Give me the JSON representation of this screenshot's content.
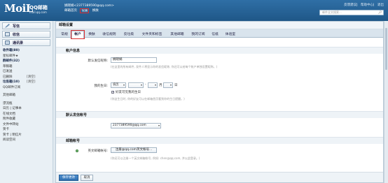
{
  "header": {
    "logo_mail": "MoiL",
    "logo_brand": "QQ邮箱",
    "logo_domain": "mail.qq.com",
    "user_line": "姚晓娟<2377389590@qq.com>",
    "nav_links": [
      "邮箱首页",
      "设置",
      "换肤"
    ],
    "top_right": [
      "反馈建议",
      "帮助中心",
      "退出"
    ],
    "search_placeholder": "邮件全文搜索..."
  },
  "sidebar": {
    "buttons": [
      {
        "label": "写信",
        "icon": "pencil-icon"
      },
      {
        "label": "收信",
        "icon": "inbox-icon"
      },
      {
        "label": "通讯录",
        "icon": "contacts-icon"
      }
    ],
    "items": [
      {
        "label": "收件箱(80)",
        "bold": true,
        "extra": ""
      },
      {
        "label": "星标邮件★",
        "bold": false,
        "extra": ""
      },
      {
        "label": "群邮件(32)",
        "bold": true,
        "extra": ""
      },
      {
        "label": "草稿箱",
        "bold": false,
        "extra": ""
      },
      {
        "label": "已发送",
        "bold": false,
        "extra": ""
      },
      {
        "label": "已删除",
        "bold": false,
        "extra": "[清空]"
      },
      {
        "label": "垃圾箱(10)",
        "bold": true,
        "extra": "[清空]"
      },
      {
        "label": "QQ邮件订阅",
        "bold": false,
        "extra": ""
      },
      {
        "label": "其他邮箱",
        "bold": false,
        "gap": true,
        "extra": ""
      },
      {
        "label": "漂流瓶",
        "bold": false,
        "gap": true,
        "extra": ""
      },
      {
        "label": "日历 | 记事本",
        "bold": false,
        "extra": ""
      },
      {
        "label": "在线文档",
        "bold": false,
        "extra": ""
      },
      {
        "label": "附件收藏",
        "bold": false,
        "extra": ""
      },
      {
        "label": "文件中转站",
        "bold": false,
        "extra": ""
      },
      {
        "label": "贺卡",
        "bold": false,
        "extra": ""
      },
      {
        "label": "贺卡 | 明信片",
        "bold": false,
        "extra": ""
      },
      {
        "label": "阅读空间",
        "bold": false,
        "extra": ""
      }
    ]
  },
  "main": {
    "title": "邮箱设置",
    "tabs": [
      "常规",
      "帐户",
      "换肤",
      "收信规则",
      "反垃圾",
      "文件夹和标签",
      "其他邮箱",
      "我的订阅",
      "信纸",
      "体验室"
    ],
    "active_tab": "帐户",
    "account_section": {
      "heading": "帐户信息",
      "nickname_label": "默认发信昵称:",
      "nickname_value": "姚晓娟",
      "nickname_hint": "(在这里的所有邮件, 发件人将显示你的发信昵称, 你还可以给每个帐户单独设置昵称。)",
      "birthday_label": "我的生日:",
      "calendar_value": "农历",
      "year_value": "",
      "month_suffix": "月",
      "day_suffix": "日",
      "friends_check_label": "好友可见我的生日",
      "birthday_hint": "(你这生日时, 你的好友可以在邮箱首页看到你的生日提醒。)"
    },
    "default_sender_section": {
      "heading": "默认发信帐号",
      "account_value": "2377389590@qq.com"
    },
    "mail_account_section": {
      "heading": "邮箱帐号",
      "english_label": "英文邮箱帐号:",
      "register_button": "注册@qq.com英文帐号...",
      "english_hint": "(你还可以注册一个英文邮箱帐号, 例如: chen@qq.com, 并以此登录。)"
    },
    "save_button": "保存更改",
    "cancel_button": "取消"
  }
}
